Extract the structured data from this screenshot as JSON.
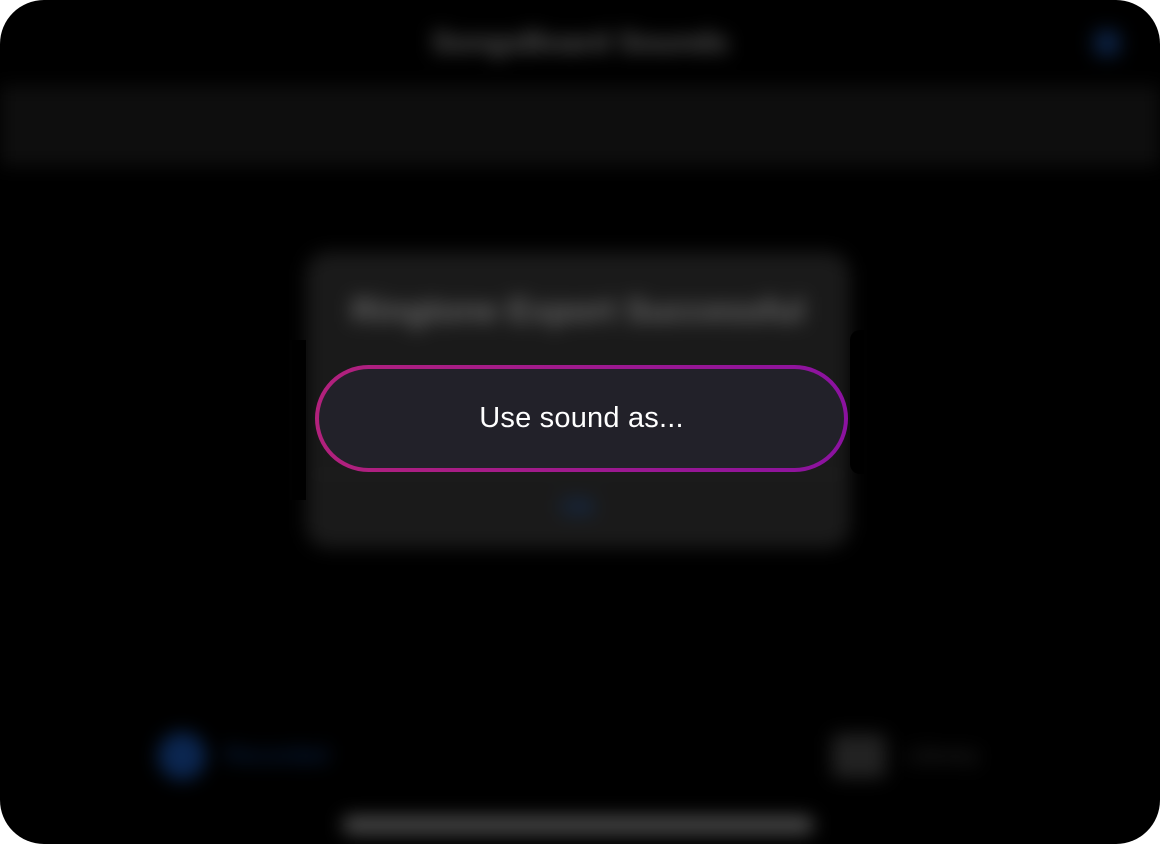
{
  "nav": {
    "title": "SongsBoard Sounds"
  },
  "background_alert": {
    "title": "Ringtone Export Successful",
    "button_label": "OK"
  },
  "tab_bar": {
    "left_label": "Recorded",
    "right_label": "Library"
  },
  "action": {
    "label": "Use sound as..."
  },
  "colors": {
    "focus_ring_start": "#b2217c",
    "focus_ring_end": "#8b12a0",
    "button_fill": "#222129",
    "background": "#000000",
    "accent_blue": "#0b2650"
  }
}
